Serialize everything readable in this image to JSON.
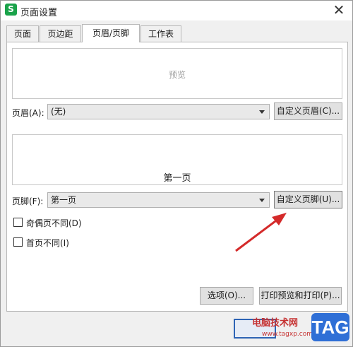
{
  "window": {
    "title": "页面设置",
    "app_icon_letter": "S",
    "close_symbol": "✕"
  },
  "tabs": [
    {
      "label": "页面"
    },
    {
      "label": "页边距"
    },
    {
      "label": "页眉/页脚",
      "active": true
    },
    {
      "label": "工作表"
    }
  ],
  "header_preview": {
    "text": "预览"
  },
  "header": {
    "label": "页眉(A):",
    "value": "(无)",
    "custom_button": "自定义页眉(C)..."
  },
  "footer_preview": {
    "text": "第一页"
  },
  "footer": {
    "label": "页脚(F):",
    "value": "第一页",
    "custom_button": "自定义页脚(U)..."
  },
  "checkboxes": [
    {
      "label": "奇偶页不同(D)",
      "checked": false
    },
    {
      "label": "首页不同(I)",
      "checked": false
    }
  ],
  "buttons": {
    "options": "选项(O)...",
    "print_preview": "打印预览和打印(P)..."
  },
  "watermark": {
    "site_name": "电脑技术网",
    "url": "www.tagxp.com",
    "tag": "TAG"
  },
  "colors": {
    "arrow": "#d42a2a",
    "app_icon": "#1aa34a",
    "tag_badge": "#2f6fd6"
  }
}
